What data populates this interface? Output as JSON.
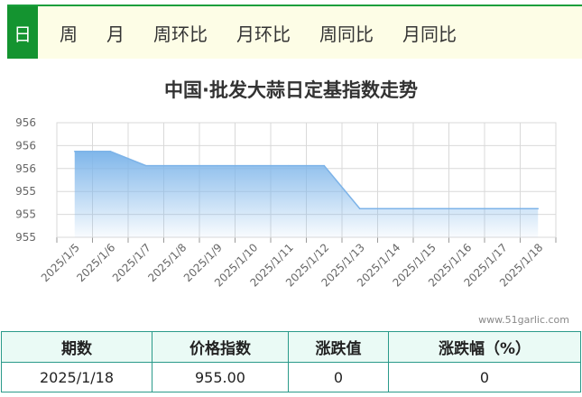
{
  "tabs": [
    {
      "label": "日",
      "active": true
    },
    {
      "label": "周",
      "active": false
    },
    {
      "label": "月",
      "active": false
    },
    {
      "label": "周环比",
      "active": false
    },
    {
      "label": "月环比",
      "active": false
    },
    {
      "label": "周同比",
      "active": false
    },
    {
      "label": "月同比",
      "active": false
    }
  ],
  "colors": {
    "accent": "#149430",
    "line": "#7db3e8",
    "fill_top": "#7fb6ea",
    "grid": "#d9d9d9"
  },
  "watermark": "www.51garlic.com",
  "chart_data": {
    "type": "area",
    "title": "中国·批发大蒜日定基指数走势",
    "x": [
      "2025/1/5",
      "2025/1/6",
      "2025/1/7",
      "2025/1/8",
      "2025/1/9",
      "2025/1/10",
      "2025/1/11",
      "2025/1/12",
      "2025/1/13",
      "2025/1/14",
      "2025/1/15",
      "2025/1/16",
      "2025/1/17",
      "2025/1/18"
    ],
    "values": [
      956.0,
      956.0,
      955.75,
      955.75,
      955.75,
      955.75,
      955.75,
      955.75,
      955.0,
      955.0,
      955.0,
      955.0,
      955.0,
      955.0
    ],
    "y_tick_labels": [
      "956",
      "956",
      "956",
      "955",
      "955",
      "955"
    ],
    "ylim": [
      954.5,
      956.5
    ],
    "grid": true,
    "legend": "none"
  },
  "table": {
    "headers": [
      "期数",
      "价格指数",
      "涨跌值",
      "涨跌幅（%）"
    ],
    "rows": [
      [
        "2025/1/18",
        "955.00",
        "0",
        "0"
      ]
    ]
  }
}
